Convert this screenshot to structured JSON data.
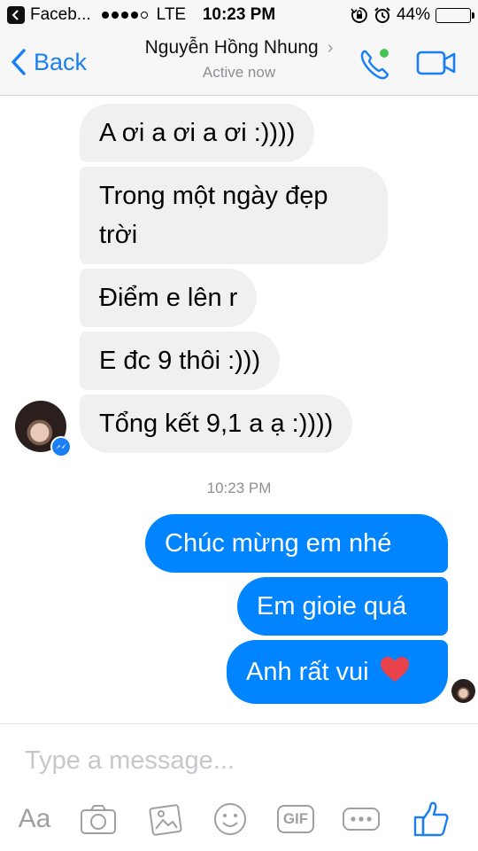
{
  "status_bar": {
    "app_name": "Faceb...",
    "carrier": "LTE",
    "time": "10:23 PM",
    "battery": "44%",
    "battery_level": 0.44
  },
  "nav": {
    "back_label": "Back",
    "contact_name": "Nguyễn Hồng Nhung",
    "status": "Active now",
    "accent_color": "#1a7ff4"
  },
  "conversation": {
    "incoming": [
      "A ơi a ơi a ơi :))))",
      "Trong một ngày đẹp",
      "trời",
      "Điểm e lên r",
      "E đc 9 thôi :)))",
      "Tổng kết 9,1 a ạ :))))"
    ],
    "timestamp": "10:23 PM",
    "outgoing": [
      "Chúc mừng em nhé",
      "Em gioie quá",
      "Anh rất vui"
    ],
    "outgoing_color": "#0084ff",
    "incoming_color": "#f1f0f0",
    "reaction_icon": "heart-icon"
  },
  "composer": {
    "placeholder": "Type a message...",
    "tools": {
      "text_style_label": "Aa",
      "gif_label": "GIF",
      "icons": [
        "camera-icon",
        "image-icon",
        "emoji-icon",
        "gif-icon",
        "more-icon",
        "like-icon"
      ]
    }
  }
}
